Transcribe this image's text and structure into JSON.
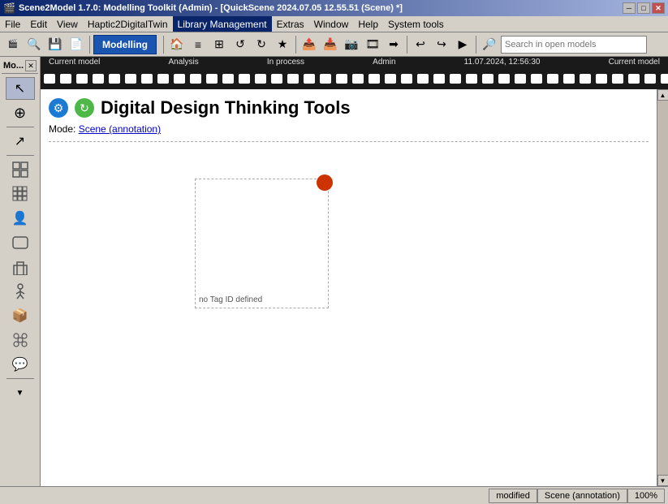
{
  "titlebar": {
    "text": "Scene2Model 1.7.0: Modelling Toolkit (Admin) - [QuickScene 2024.07.05 12.55.51 (Scene) *]",
    "minimize": "─",
    "restore": "□",
    "close": "✕"
  },
  "menubar": {
    "items": [
      "File",
      "Edit",
      "View",
      "Haptic2DigitalTwin",
      "Library Management",
      "Extras",
      "Window",
      "Help",
      "System tools"
    ]
  },
  "toolbar": {
    "modelling_label": "Modelling",
    "search_placeholder": "Search in open models"
  },
  "toolbox": {
    "title": "Mo...",
    "tools": [
      {
        "icon": "↖",
        "name": "select"
      },
      {
        "icon": "⊕",
        "name": "plus"
      },
      {
        "icon": "↗",
        "name": "arrow"
      },
      {
        "icon": "▦",
        "name": "grid-large"
      },
      {
        "icon": "▤",
        "name": "grid-small"
      },
      {
        "icon": "👤",
        "name": "person"
      },
      {
        "icon": "▭",
        "name": "rounded-rect"
      },
      {
        "icon": "▦",
        "name": "building"
      },
      {
        "icon": "👤",
        "name": "figure"
      },
      {
        "icon": "📦",
        "name": "box"
      },
      {
        "icon": "⚙",
        "name": "gear"
      },
      {
        "icon": "💬",
        "name": "speech"
      }
    ]
  },
  "filmstrip": {
    "info": {
      "current_model": "Current model",
      "analysis": "Analysis",
      "in_process": "In process",
      "admin": "Admin",
      "timestamp": "11.07.2024, 12:56:30",
      "current_model2": "Current model"
    }
  },
  "page": {
    "title": "Digital Design Thinking Tools",
    "mode_label": "Mode:",
    "mode_link": "Scene (annotation)",
    "tag_label": "no Tag ID defined"
  },
  "statusbar": {
    "modified": "modified",
    "scene": "Scene (annotation)",
    "zoom": "100%"
  },
  "colors": {
    "accent_blue": "#1a56b0",
    "dot_red": "#cc3300",
    "icon_blue": "#1a7ad4",
    "icon_green": "#4db848"
  }
}
